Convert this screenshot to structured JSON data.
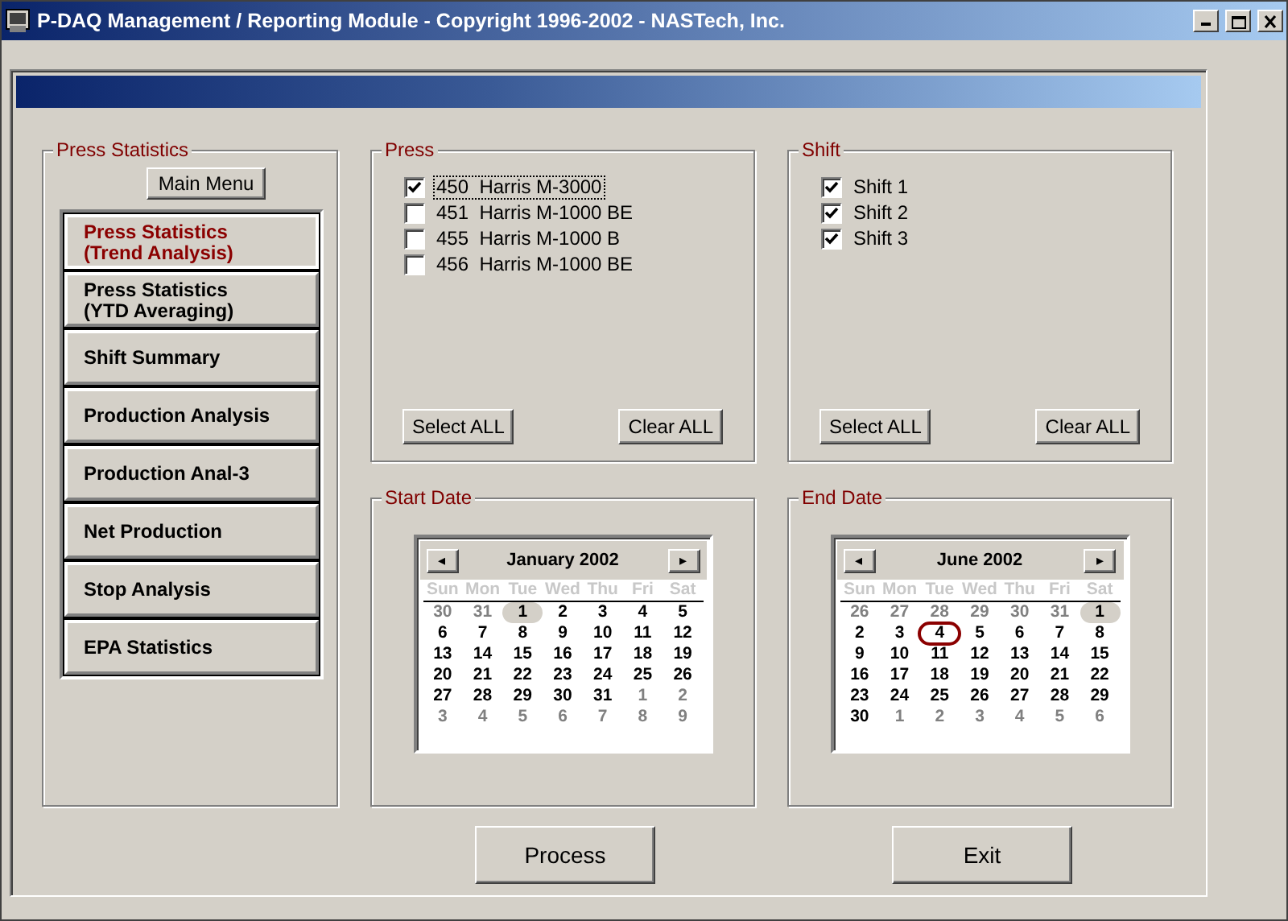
{
  "window": {
    "title": "P-DAQ Management / Reporting Module - Copyright 1996-2002 - NASTech, Inc."
  },
  "menu_group": {
    "title": "Press Statistics",
    "main_menu_button": "Main Menu",
    "items": [
      {
        "label": "Press Statistics\n(Trend Analysis)",
        "selected": true
      },
      {
        "label": "Press Statistics\n(YTD Averaging)",
        "selected": false
      },
      {
        "label": "Shift Summary",
        "selected": false
      },
      {
        "label": "Production Analysis",
        "selected": false
      },
      {
        "label": "Production Anal-3",
        "selected": false
      },
      {
        "label": "Net Production",
        "selected": false
      },
      {
        "label": "Stop Analysis",
        "selected": false
      },
      {
        "label": "EPA Statistics",
        "selected": false
      }
    ]
  },
  "press": {
    "title": "Press",
    "items": [
      {
        "number": "450",
        "name": "Harris M-3000",
        "checked": true,
        "focused": true
      },
      {
        "number": "451",
        "name": "Harris M-1000 BE",
        "checked": false,
        "focused": false
      },
      {
        "number": "455",
        "name": "Harris M-1000 B",
        "checked": false,
        "focused": false
      },
      {
        "number": "456",
        "name": "Harris M-1000 BE",
        "checked": false,
        "focused": false
      }
    ],
    "buttons": [
      "Select ALL",
      "Clear ALL"
    ]
  },
  "shift": {
    "title": "Shift",
    "items": [
      {
        "name": "Shift 1",
        "checked": true
      },
      {
        "name": "Shift 2",
        "checked": true
      },
      {
        "name": "Shift 3",
        "checked": true
      }
    ],
    "buttons": [
      "Select ALL",
      "Clear ALL"
    ]
  },
  "start_date": {
    "title": "Start Date",
    "prev": "◂",
    "next": "▸",
    "month": "January 2002",
    "weekdays": [
      "Sun",
      "Mon",
      "Tue",
      "Wed",
      "Thu",
      "Fri",
      "Sat"
    ],
    "days": [
      {
        "day": "30",
        "muted": true,
        "selected": false,
        "today": false
      },
      {
        "day": "31",
        "muted": true,
        "selected": false,
        "today": false
      },
      {
        "day": "1",
        "muted": false,
        "selected": true,
        "today": false
      },
      {
        "day": "2",
        "muted": false,
        "selected": false,
        "today": false
      },
      {
        "day": "3",
        "muted": false,
        "selected": false,
        "today": false
      },
      {
        "day": "4",
        "muted": false,
        "selected": false,
        "today": false
      },
      {
        "day": "5",
        "muted": false,
        "selected": false,
        "today": false
      },
      {
        "day": "6",
        "muted": false,
        "selected": false,
        "today": false
      },
      {
        "day": "7",
        "muted": false,
        "selected": false,
        "today": false
      },
      {
        "day": "8",
        "muted": false,
        "selected": false,
        "today": false
      },
      {
        "day": "9",
        "muted": false,
        "selected": false,
        "today": false
      },
      {
        "day": "10",
        "muted": false,
        "selected": false,
        "today": false
      },
      {
        "day": "11",
        "muted": false,
        "selected": false,
        "today": false
      },
      {
        "day": "12",
        "muted": false,
        "selected": false,
        "today": false
      },
      {
        "day": "13",
        "muted": false,
        "selected": false,
        "today": false
      },
      {
        "day": "14",
        "muted": false,
        "selected": false,
        "today": false
      },
      {
        "day": "15",
        "muted": false,
        "selected": false,
        "today": false
      },
      {
        "day": "16",
        "muted": false,
        "selected": false,
        "today": false
      },
      {
        "day": "17",
        "muted": false,
        "selected": false,
        "today": false
      },
      {
        "day": "18",
        "muted": false,
        "selected": false,
        "today": false
      },
      {
        "day": "19",
        "muted": false,
        "selected": false,
        "today": false
      },
      {
        "day": "20",
        "muted": false,
        "selected": false,
        "today": false
      },
      {
        "day": "21",
        "muted": false,
        "selected": false,
        "today": false
      },
      {
        "day": "22",
        "muted": false,
        "selected": false,
        "today": false
      },
      {
        "day": "23",
        "muted": false,
        "selected": false,
        "today": false
      },
      {
        "day": "24",
        "muted": false,
        "selected": false,
        "today": false
      },
      {
        "day": "25",
        "muted": false,
        "selected": false,
        "today": false
      },
      {
        "day": "26",
        "muted": false,
        "selected": false,
        "today": false
      },
      {
        "day": "27",
        "muted": false,
        "selected": false,
        "today": false
      },
      {
        "day": "28",
        "muted": false,
        "selected": false,
        "today": false
      },
      {
        "day": "29",
        "muted": false,
        "selected": false,
        "today": false
      },
      {
        "day": "30",
        "muted": false,
        "selected": false,
        "today": false
      },
      {
        "day": "31",
        "muted": false,
        "selected": false,
        "today": false
      },
      {
        "day": "1",
        "muted": true,
        "selected": false,
        "today": false
      },
      {
        "day": "2",
        "muted": true,
        "selected": false,
        "today": false
      },
      {
        "day": "3",
        "muted": true,
        "selected": false,
        "today": false
      },
      {
        "day": "4",
        "muted": true,
        "selected": false,
        "today": false
      },
      {
        "day": "5",
        "muted": true,
        "selected": false,
        "today": false
      },
      {
        "day": "6",
        "muted": true,
        "selected": false,
        "today": false
      },
      {
        "day": "7",
        "muted": true,
        "selected": false,
        "today": false
      },
      {
        "day": "8",
        "muted": true,
        "selected": false,
        "today": false
      },
      {
        "day": "9",
        "muted": true,
        "selected": false,
        "today": false
      }
    ]
  },
  "end_date": {
    "title": "End Date",
    "prev": "◂",
    "next": "▸",
    "month": "June 2002",
    "weekdays": [
      "Sun",
      "Mon",
      "Tue",
      "Wed",
      "Thu",
      "Fri",
      "Sat"
    ],
    "days": [
      {
        "day": "26",
        "muted": true,
        "selected": false,
        "today": false
      },
      {
        "day": "27",
        "muted": true,
        "selected": false,
        "today": false
      },
      {
        "day": "28",
        "muted": true,
        "selected": false,
        "today": false
      },
      {
        "day": "29",
        "muted": true,
        "selected": false,
        "today": false
      },
      {
        "day": "30",
        "muted": true,
        "selected": false,
        "today": false
      },
      {
        "day": "31",
        "muted": true,
        "selected": false,
        "today": false
      },
      {
        "day": "1",
        "muted": false,
        "selected": true,
        "today": false
      },
      {
        "day": "2",
        "muted": false,
        "selected": false,
        "today": false
      },
      {
        "day": "3",
        "muted": false,
        "selected": false,
        "today": false
      },
      {
        "day": "4",
        "muted": false,
        "selected": false,
        "today": true
      },
      {
        "day": "5",
        "muted": false,
        "selected": false,
        "today": false
      },
      {
        "day": "6",
        "muted": false,
        "selected": false,
        "today": false
      },
      {
        "day": "7",
        "muted": false,
        "selected": false,
        "today": false
      },
      {
        "day": "8",
        "muted": false,
        "selected": false,
        "today": false
      },
      {
        "day": "9",
        "muted": false,
        "selected": false,
        "today": false
      },
      {
        "day": "10",
        "muted": false,
        "selected": false,
        "today": false
      },
      {
        "day": "11",
        "muted": false,
        "selected": false,
        "today": false
      },
      {
        "day": "12",
        "muted": false,
        "selected": false,
        "today": false
      },
      {
        "day": "13",
        "muted": false,
        "selected": false,
        "today": false
      },
      {
        "day": "14",
        "muted": false,
        "selected": false,
        "today": false
      },
      {
        "day": "15",
        "muted": false,
        "selected": false,
        "today": false
      },
      {
        "day": "16",
        "muted": false,
        "selected": false,
        "today": false
      },
      {
        "day": "17",
        "muted": false,
        "selected": false,
        "today": false
      },
      {
        "day": "18",
        "muted": false,
        "selected": false,
        "today": false
      },
      {
        "day": "19",
        "muted": false,
        "selected": false,
        "today": false
      },
      {
        "day": "20",
        "muted": false,
        "selected": false,
        "today": false
      },
      {
        "day": "21",
        "muted": false,
        "selected": false,
        "today": false
      },
      {
        "day": "22",
        "muted": false,
        "selected": false,
        "today": false
      },
      {
        "day": "23",
        "muted": false,
        "selected": false,
        "today": false
      },
      {
        "day": "24",
        "muted": false,
        "selected": false,
        "today": false
      },
      {
        "day": "25",
        "muted": false,
        "selected": false,
        "today": false
      },
      {
        "day": "26",
        "muted": false,
        "selected": false,
        "today": false
      },
      {
        "day": "27",
        "muted": false,
        "selected": false,
        "today": false
      },
      {
        "day": "28",
        "muted": false,
        "selected": false,
        "today": false
      },
      {
        "day": "29",
        "muted": false,
        "selected": false,
        "today": false
      },
      {
        "day": "30",
        "muted": false,
        "selected": false,
        "today": false
      },
      {
        "day": "1",
        "muted": true,
        "selected": false,
        "today": false
      },
      {
        "day": "2",
        "muted": true,
        "selected": false,
        "today": false
      },
      {
        "day": "3",
        "muted": true,
        "selected": false,
        "today": false
      },
      {
        "day": "4",
        "muted": true,
        "selected": false,
        "today": false
      },
      {
        "day": "5",
        "muted": true,
        "selected": false,
        "today": false
      },
      {
        "day": "6",
        "muted": true,
        "selected": false,
        "today": false
      }
    ]
  },
  "actions": [
    "Process",
    "Exit"
  ]
}
